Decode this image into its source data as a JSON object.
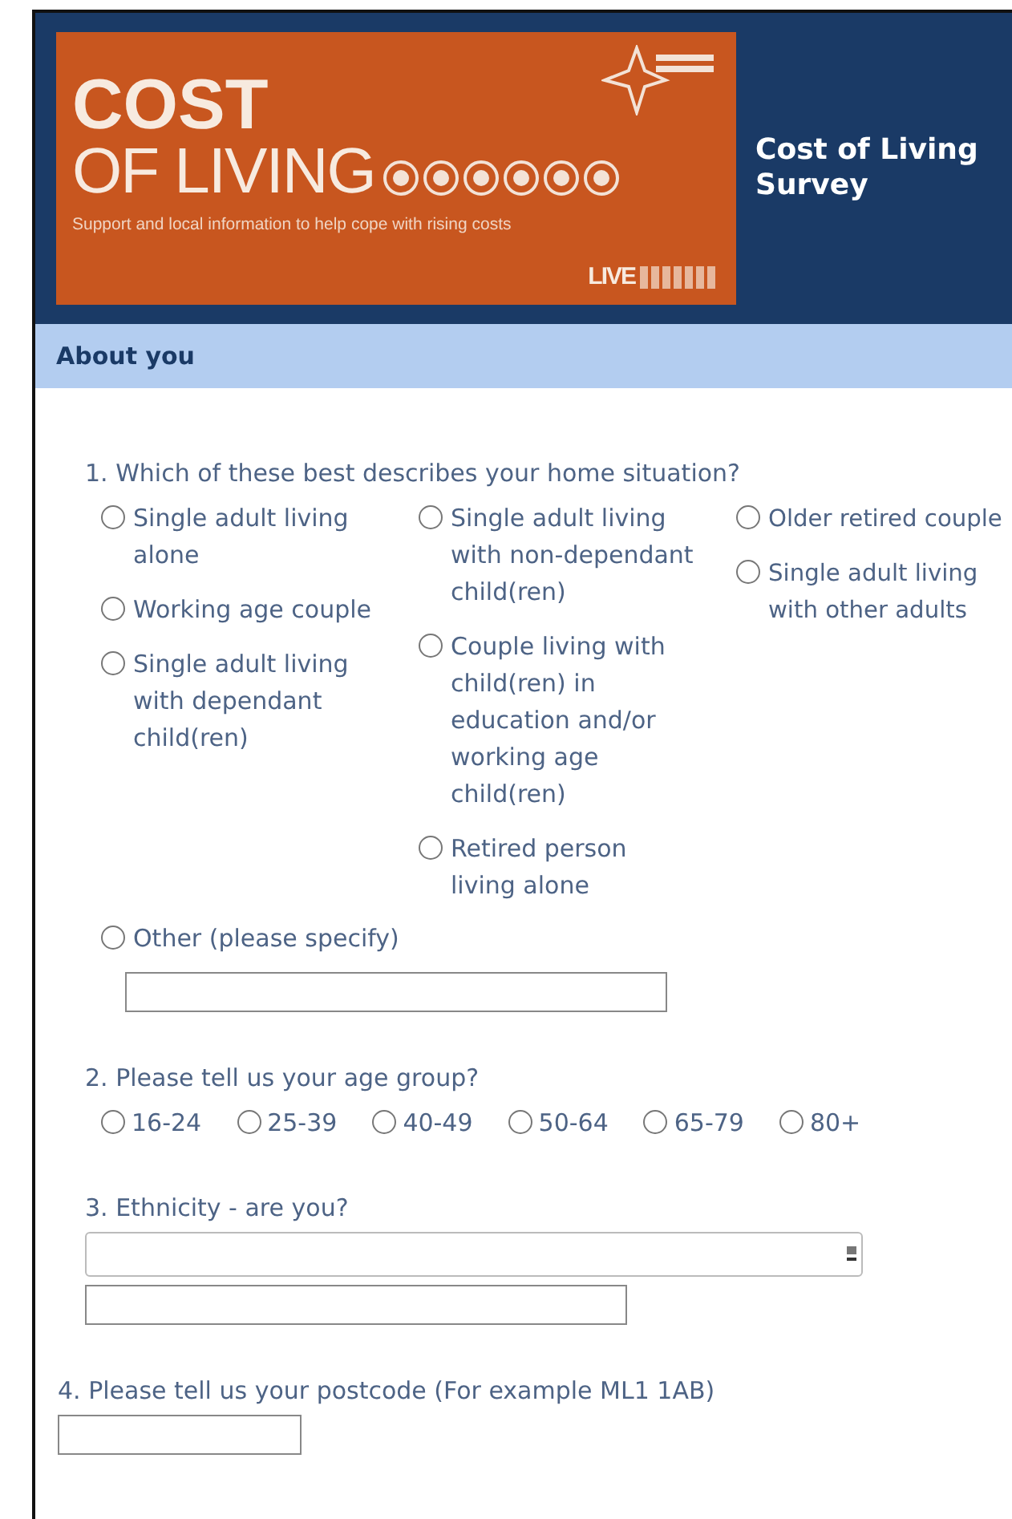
{
  "banner": {
    "title_line1": "COST",
    "title_line2": "OF LIVING",
    "tagline": "Support and local information to help cope with rising costs",
    "badge": "LIVE"
  },
  "header": {
    "title": "Cost of Living Survey"
  },
  "section": {
    "title": "About you"
  },
  "questions": [
    {
      "kind": "radio_columns",
      "label": "1. Which of these best describes your home situation?",
      "columns": [
        [
          {
            "label": "Single adult living alone",
            "selected": false
          },
          {
            "label": "Working age couple",
            "selected": false
          },
          {
            "label": "Single adult living with dependant child(ren)",
            "selected": false
          }
        ],
        [
          {
            "label": "Single adult living with non-dependant child(ren)",
            "selected": false
          },
          {
            "label": "Couple living with child(ren) in education and/or working age child(ren)",
            "selected": false
          },
          {
            "label": "Retired person living alone",
            "selected": false
          }
        ],
        [
          {
            "label": "Older retired couple",
            "selected": false
          },
          {
            "label": "Single adult living with other adults",
            "selected": false
          }
        ]
      ],
      "other": {
        "label": "Other (please specify)",
        "selected": false
      }
    },
    {
      "kind": "radio_row",
      "label": "2. Please tell us your age group?",
      "options": [
        {
          "label": "16-24",
          "selected": false
        },
        {
          "label": "25-39",
          "selected": false
        },
        {
          "label": "40-49",
          "selected": false
        },
        {
          "label": "50-64",
          "selected": false
        },
        {
          "label": "65-79",
          "selected": false
        },
        {
          "label": "80+",
          "selected": false
        }
      ]
    },
    {
      "kind": "select_and_text",
      "label": "3. Ethnicity - are you?"
    },
    {
      "kind": "text",
      "label": "4. Please tell us your postcode (For example ML1 1AB)"
    }
  ]
}
